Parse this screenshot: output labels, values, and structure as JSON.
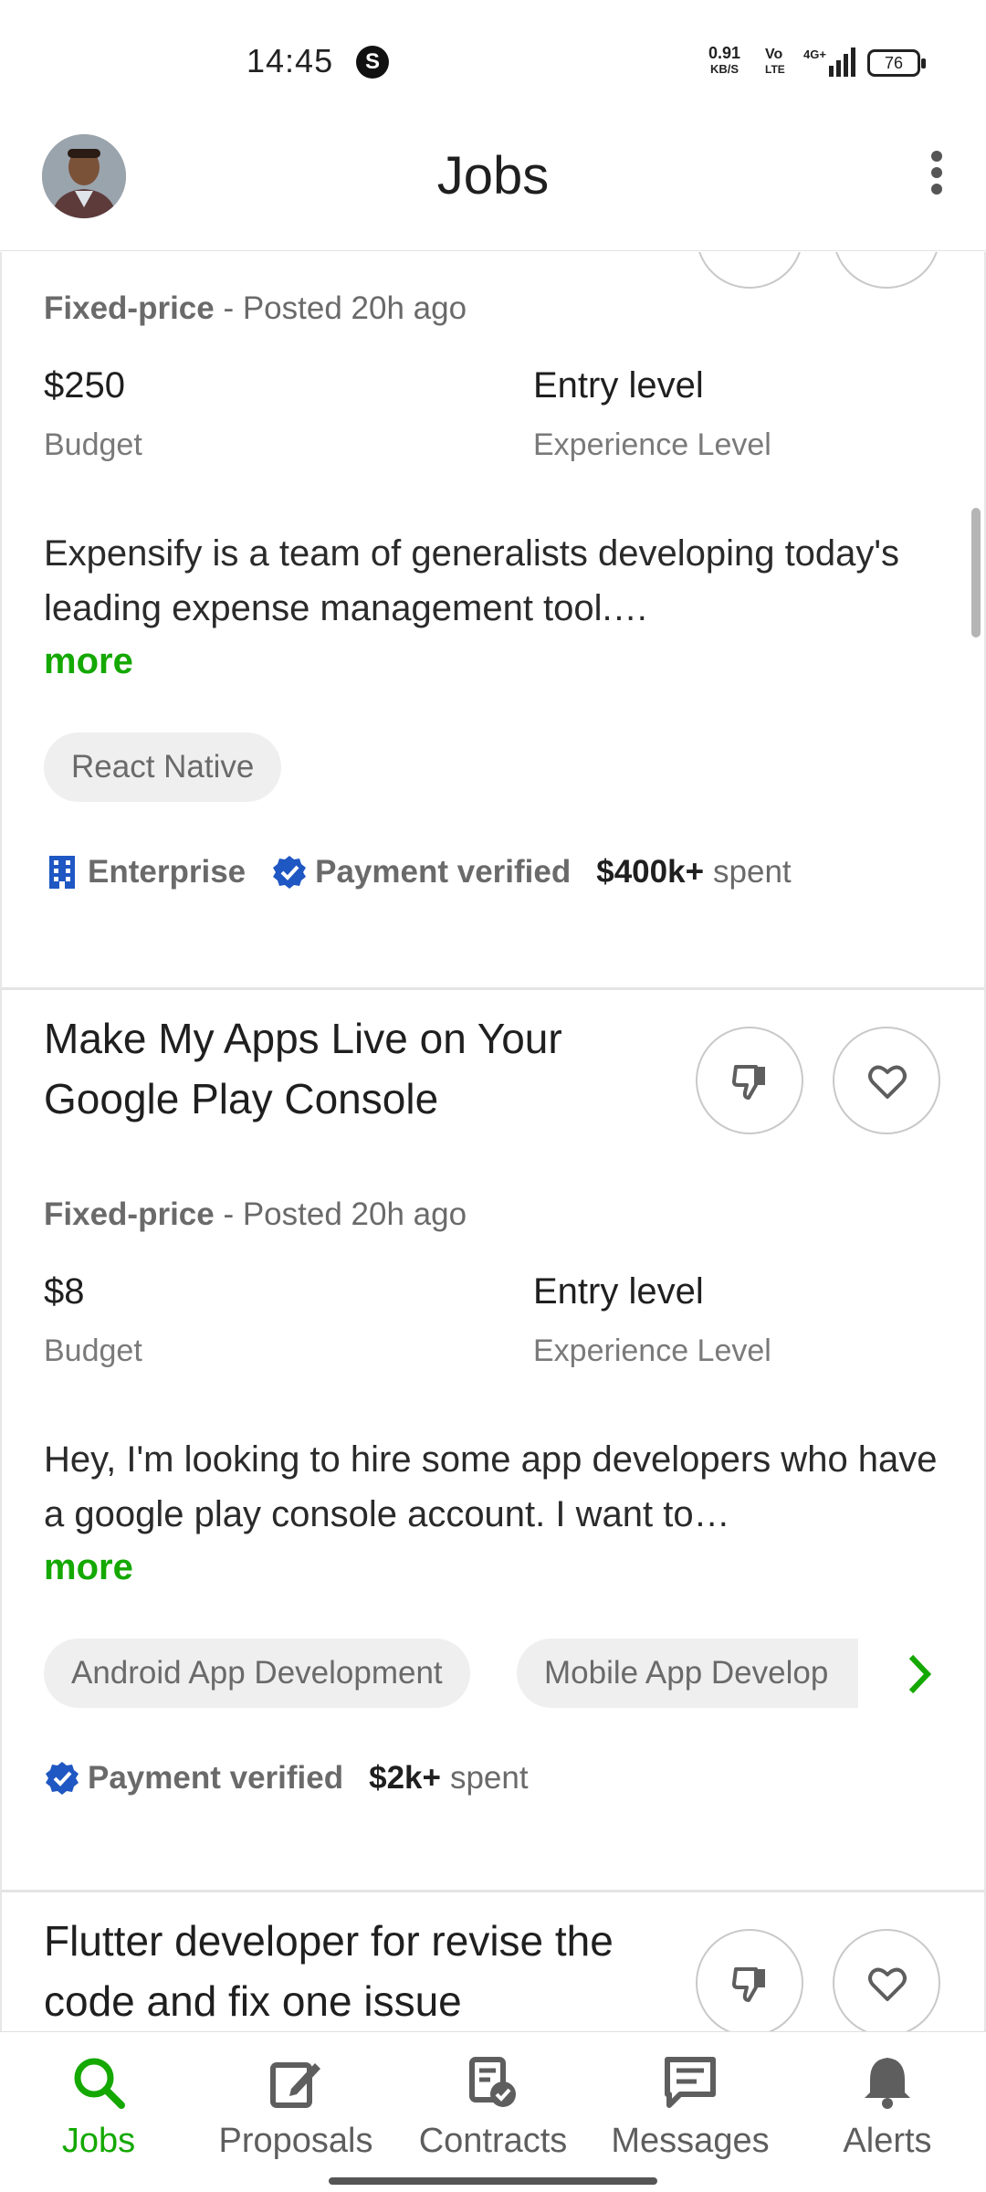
{
  "status_bar": {
    "time": "14:45",
    "s_badge": "S",
    "speed_value": "0.91",
    "speed_unit": "KB/S",
    "volte_top": "Vo",
    "volte_bottom": "LTE",
    "battery": "76"
  },
  "header": {
    "title": "Jobs"
  },
  "jobs": [
    {
      "title_visible": false,
      "type": "Fixed-price",
      "posted": " - Posted 20h ago",
      "budget_value": "$250",
      "budget_label": "Budget",
      "level_value": "Entry level",
      "level_label": "Experience Level",
      "description": "Expensify is a team of generalists developing today's leading expense management tool.…",
      "more": "more",
      "skills": [
        "React Native"
      ],
      "client": {
        "enterprise": "Enterprise",
        "payment": "Payment verified",
        "spent_value": "$400k+",
        "spent_label": "spent"
      }
    },
    {
      "title": "Make My Apps Live on Your Google Play Console",
      "type": "Fixed-price",
      "posted": " - Posted 20h ago",
      "budget_value": "$8",
      "budget_label": "Budget",
      "level_value": "Entry level",
      "level_label": "Experience Level",
      "description": "Hey, I'm looking to hire some app developers who have a google play console account. I want to…",
      "more": "more",
      "skills": [
        "Android App Development",
        "Mobile App Develop"
      ],
      "client": {
        "payment": "Payment verified",
        "spent_value": "$2k+",
        "spent_label": "spent"
      }
    },
    {
      "title": "Flutter developer for revise the code and fix one issue"
    }
  ],
  "bottom_nav": [
    {
      "label": "Jobs",
      "icon": "search-icon",
      "active": true
    },
    {
      "label": "Proposals",
      "icon": "edit-icon",
      "active": false
    },
    {
      "label": "Contracts",
      "icon": "contract-icon",
      "active": false
    },
    {
      "label": "Messages",
      "icon": "message-icon",
      "active": false
    },
    {
      "label": "Alerts",
      "icon": "bell-icon",
      "active": false
    }
  ],
  "colors": {
    "accent": "#14a800",
    "verified": "#1f57c3"
  }
}
